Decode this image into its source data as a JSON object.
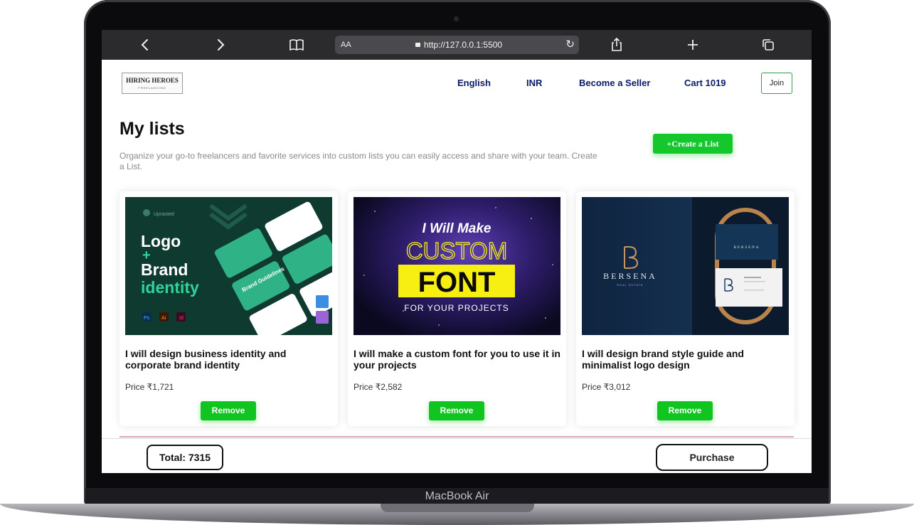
{
  "device": {
    "chin_label": "MacBook Air"
  },
  "browser": {
    "text_size_label": "AA",
    "url": "http://127.0.0.1:5500"
  },
  "header": {
    "logo_text": "HIRING HEROES",
    "logo_subtext": "FREELANCING",
    "nav": {
      "language": "English",
      "currency": "INR",
      "become_seller": "Become a Seller",
      "cart": "Cart 1019"
    },
    "join_label": "Join"
  },
  "page": {
    "title": "My lists",
    "description": "Organize your go-to freelancers and favorite services into custom lists you can easily access and share with your team. Create a List.",
    "create_button": "+Create a List"
  },
  "cards": [
    {
      "title": "I will design business identity and corporate brand identity",
      "price": "Price ₹1,721",
      "remove_label": "Remove",
      "image": {
        "brand_small": "Upraoted",
        "line1": "Logo",
        "line2": "+",
        "line3": "Brand",
        "line4": "identity",
        "tag1": "Ps",
        "tag2": "Ai",
        "tag3": "Id",
        "card_text": "Brand Guidelines"
      }
    },
    {
      "title": "I will make a custom font for you to use it in your projects",
      "price": "Price ₹2,582",
      "remove_label": "Remove",
      "image": {
        "line1": "I Will Make",
        "line2": "CUSTOM",
        "line3": "FONT",
        "line4": "FOR YOUR PROJECTS"
      }
    },
    {
      "title": "I will design brand style guide and minimalist logo design",
      "price": "Price ₹3,012",
      "remove_label": "Remove",
      "image": {
        "brand": "BERSENA",
        "sub": "REAL ESTATE"
      }
    }
  ],
  "footer": {
    "total": "Total: 7315",
    "purchase_label": "Purchase"
  },
  "colors": {
    "accent_green": "#14c72b",
    "nav_text": "#0b1a66"
  }
}
